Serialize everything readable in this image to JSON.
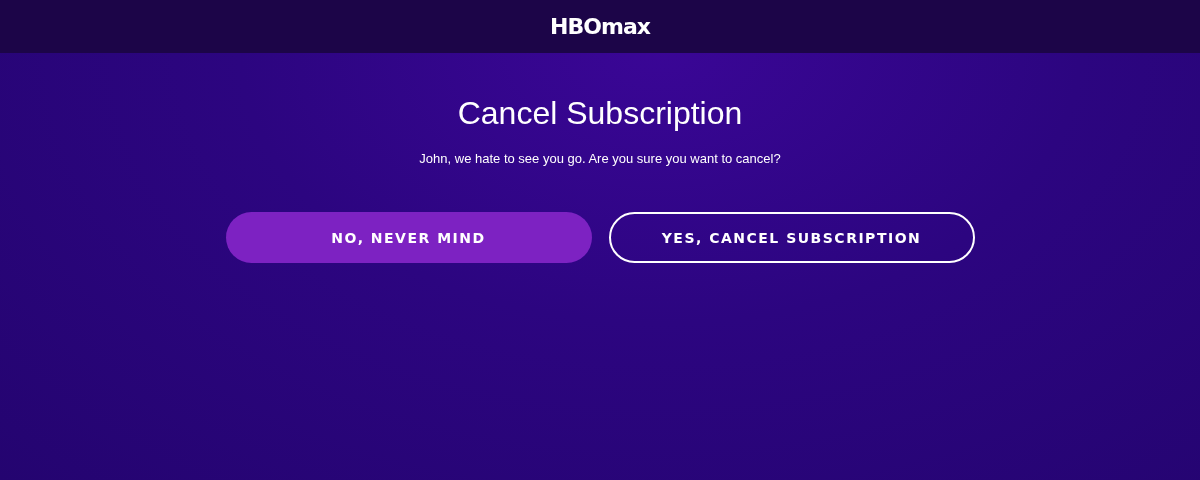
{
  "header": {
    "logo": "HBOmax"
  },
  "dialog": {
    "title": "Cancel Subscription",
    "message": "John, we hate to see you go. Are you sure you want to cancel?"
  },
  "buttons": [
    {
      "label": "NO, NEVER MIND",
      "kind": "primary"
    },
    {
      "label": "YES, CANCEL SUBSCRIPTION",
      "kind": "outline"
    }
  ]
}
